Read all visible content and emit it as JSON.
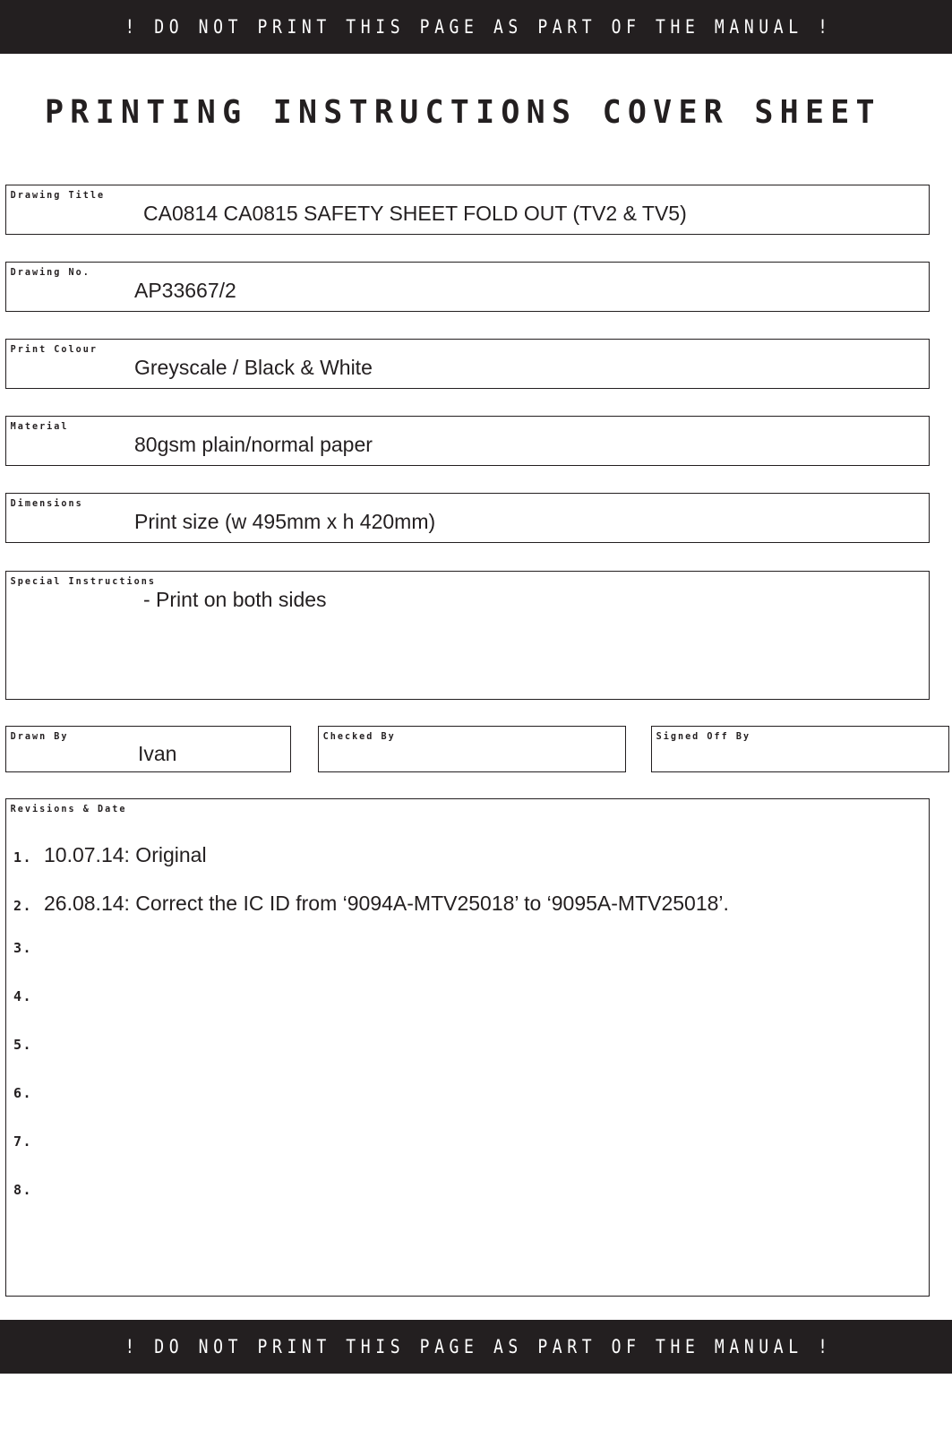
{
  "warning": {
    "top_text": "! DO NOT PRINT THIS PAGE AS PART OF THE MANUAL !",
    "bottom_text": "! DO NOT PRINT THIS PAGE AS PART OF THE MANUAL !",
    "bar_color": "#231f20",
    "text_color": "#ffffff"
  },
  "page": {
    "title": "PRINTING INSTRUCTIONS COVER SHEET"
  },
  "fields": {
    "drawing_title": {
      "label": "Drawing Title",
      "value": "CA0814 CA0815 SAFETY SHEET FOLD OUT (TV2 & TV5)"
    },
    "drawing_no": {
      "label": "Drawing No.",
      "value": "AP33667/2"
    },
    "print_colour": {
      "label": "Print Colour",
      "value": "Greyscale / Black & White"
    },
    "material": {
      "label": "Material",
      "value": "80gsm plain/normal paper"
    },
    "dimensions": {
      "label": "Dimensions",
      "value": "Print size (w 495mm x h 420mm)"
    },
    "special_instructions": {
      "label": "Special Instructions",
      "value": "- Print on both sides"
    }
  },
  "signatures": {
    "drawn_by": {
      "label": "Drawn By",
      "value": "Ivan"
    },
    "checked_by": {
      "label": "Checked By",
      "value": ""
    },
    "signed_off_by": {
      "label": "Signed Off By",
      "value": ""
    }
  },
  "revisions": {
    "label": "Revisions & Date",
    "items": [
      {
        "num": "1.",
        "text": "10.07.14:  Original"
      },
      {
        "num": "2.",
        "text": "26.08.14:  Correct the IC ID from ‘9094A-MTV25018’ to ‘9095A-MTV25018’."
      },
      {
        "num": "3.",
        "text": ""
      },
      {
        "num": "4.",
        "text": ""
      },
      {
        "num": "5.",
        "text": ""
      },
      {
        "num": "6.",
        "text": ""
      },
      {
        "num": "7.",
        "text": ""
      },
      {
        "num": "8.",
        "text": ""
      }
    ]
  }
}
